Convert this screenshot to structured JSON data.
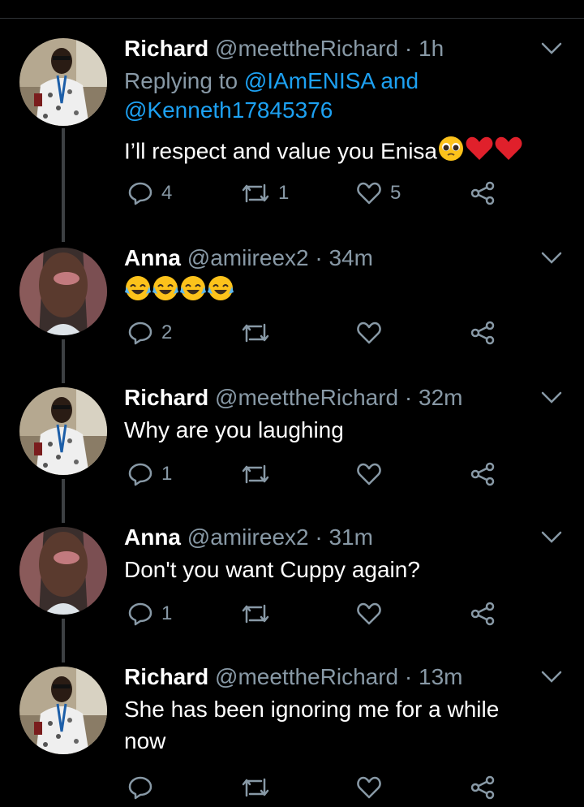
{
  "thread": [
    {
      "name": "Richard",
      "handle": "@meettheRichard",
      "sep": "·",
      "time": "1h",
      "reply_prefix": "Replying to",
      "reply_user1": "@IAmENISA",
      "reply_and": "and",
      "reply_user2": "@Kenneth17845376",
      "text": "I’ll respect and value you Enisa",
      "emojis": [
        "pleading-face-emoji",
        "red-heart-emoji",
        "red-heart-emoji"
      ],
      "replies": "4",
      "retweets": "1",
      "likes": "5"
    },
    {
      "name": "Anna",
      "handle": "@amiireex2",
      "sep": "·",
      "time": "34m",
      "emojis": [
        "face-with-tears-of-joy-emoji",
        "face-with-tears-of-joy-emoji",
        "face-with-tears-of-joy-emoji",
        "face-with-tears-of-joy-emoji"
      ],
      "replies": "2",
      "retweets": "",
      "likes": ""
    },
    {
      "name": "Richard",
      "handle": "@meettheRichard",
      "sep": "·",
      "time": "32m",
      "text": "Why are you laughing",
      "replies": "1",
      "retweets": "",
      "likes": ""
    },
    {
      "name": "Anna",
      "handle": "@amiireex2",
      "sep": "·",
      "time": "31m",
      "text": "Don't you want Cuppy again?",
      "replies": "1",
      "retweets": "",
      "likes": ""
    },
    {
      "name": "Richard",
      "handle": "@meettheRichard",
      "sep": "·",
      "time": "13m",
      "text_line1": "She has been ignoring me for a while",
      "text_line2": "now"
    }
  ],
  "colors": {
    "background": "#000000",
    "primary_text": "#ffffff",
    "secondary_text": "#8899a6",
    "link": "#1da1f2",
    "thread_line": "#3d4043"
  },
  "icons": [
    "reply-icon",
    "retweet-icon",
    "like-icon",
    "share-icon",
    "chevron-down-icon"
  ]
}
